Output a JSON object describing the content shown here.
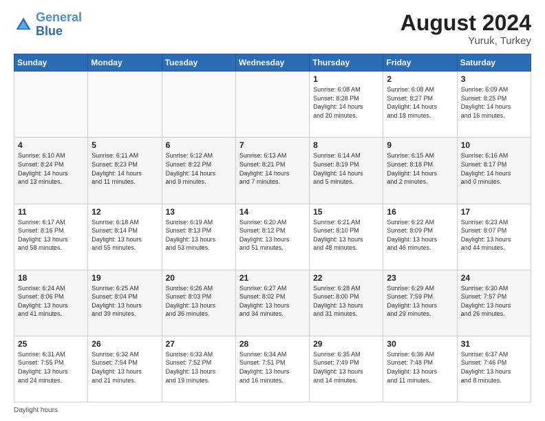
{
  "header": {
    "logo_text_general": "General",
    "logo_text_blue": "Blue",
    "month_year": "August 2024",
    "location": "Yuruk, Turkey"
  },
  "footer": {
    "daylight_label": "Daylight hours"
  },
  "days_of_week": [
    "Sunday",
    "Monday",
    "Tuesday",
    "Wednesday",
    "Thursday",
    "Friday",
    "Saturday"
  ],
  "weeks": [
    {
      "days": [
        {
          "number": "",
          "info": ""
        },
        {
          "number": "",
          "info": ""
        },
        {
          "number": "",
          "info": ""
        },
        {
          "number": "",
          "info": ""
        },
        {
          "number": "1",
          "info": "Sunrise: 6:08 AM\nSunset: 8:28 PM\nDaylight: 14 hours\nand 20 minutes."
        },
        {
          "number": "2",
          "info": "Sunrise: 6:08 AM\nSunset: 8:27 PM\nDaylight: 14 hours\nand 18 minutes."
        },
        {
          "number": "3",
          "info": "Sunrise: 6:09 AM\nSunset: 8:25 PM\nDaylight: 14 hours\nand 16 minutes."
        }
      ]
    },
    {
      "days": [
        {
          "number": "4",
          "info": "Sunrise: 6:10 AM\nSunset: 8:24 PM\nDaylight: 14 hours\nand 13 minutes."
        },
        {
          "number": "5",
          "info": "Sunrise: 6:11 AM\nSunset: 8:23 PM\nDaylight: 14 hours\nand 11 minutes."
        },
        {
          "number": "6",
          "info": "Sunrise: 6:12 AM\nSunset: 8:22 PM\nDaylight: 14 hours\nand 9 minutes."
        },
        {
          "number": "7",
          "info": "Sunrise: 6:13 AM\nSunset: 8:21 PM\nDaylight: 14 hours\nand 7 minutes."
        },
        {
          "number": "8",
          "info": "Sunrise: 6:14 AM\nSunset: 8:19 PM\nDaylight: 14 hours\nand 5 minutes."
        },
        {
          "number": "9",
          "info": "Sunrise: 6:15 AM\nSunset: 8:18 PM\nDaylight: 14 hours\nand 2 minutes."
        },
        {
          "number": "10",
          "info": "Sunrise: 6:16 AM\nSunset: 8:17 PM\nDaylight: 14 hours\nand 0 minutes."
        }
      ]
    },
    {
      "days": [
        {
          "number": "11",
          "info": "Sunrise: 6:17 AM\nSunset: 8:16 PM\nDaylight: 13 hours\nand 58 minutes."
        },
        {
          "number": "12",
          "info": "Sunrise: 6:18 AM\nSunset: 8:14 PM\nDaylight: 13 hours\nand 55 minutes."
        },
        {
          "number": "13",
          "info": "Sunrise: 6:19 AM\nSunset: 8:13 PM\nDaylight: 13 hours\nand 53 minutes."
        },
        {
          "number": "14",
          "info": "Sunrise: 6:20 AM\nSunset: 8:12 PM\nDaylight: 13 hours\nand 51 minutes."
        },
        {
          "number": "15",
          "info": "Sunrise: 6:21 AM\nSunset: 8:10 PM\nDaylight: 13 hours\nand 48 minutes."
        },
        {
          "number": "16",
          "info": "Sunrise: 6:22 AM\nSunset: 8:09 PM\nDaylight: 13 hours\nand 46 minutes."
        },
        {
          "number": "17",
          "info": "Sunrise: 6:23 AM\nSunset: 8:07 PM\nDaylight: 13 hours\nand 44 minutes."
        }
      ]
    },
    {
      "days": [
        {
          "number": "18",
          "info": "Sunrise: 6:24 AM\nSunset: 8:06 PM\nDaylight: 13 hours\nand 41 minutes."
        },
        {
          "number": "19",
          "info": "Sunrise: 6:25 AM\nSunset: 8:04 PM\nDaylight: 13 hours\nand 39 minutes."
        },
        {
          "number": "20",
          "info": "Sunrise: 6:26 AM\nSunset: 8:03 PM\nDaylight: 13 hours\nand 36 minutes."
        },
        {
          "number": "21",
          "info": "Sunrise: 6:27 AM\nSunset: 8:02 PM\nDaylight: 13 hours\nand 34 minutes."
        },
        {
          "number": "22",
          "info": "Sunrise: 6:28 AM\nSunset: 8:00 PM\nDaylight: 13 hours\nand 31 minutes."
        },
        {
          "number": "23",
          "info": "Sunrise: 6:29 AM\nSunset: 7:59 PM\nDaylight: 13 hours\nand 29 minutes."
        },
        {
          "number": "24",
          "info": "Sunrise: 6:30 AM\nSunset: 7:57 PM\nDaylight: 13 hours\nand 26 minutes."
        }
      ]
    },
    {
      "days": [
        {
          "number": "25",
          "info": "Sunrise: 6:31 AM\nSunset: 7:55 PM\nDaylight: 13 hours\nand 24 minutes."
        },
        {
          "number": "26",
          "info": "Sunrise: 6:32 AM\nSunset: 7:54 PM\nDaylight: 13 hours\nand 21 minutes."
        },
        {
          "number": "27",
          "info": "Sunrise: 6:33 AM\nSunset: 7:52 PM\nDaylight: 13 hours\nand 19 minutes."
        },
        {
          "number": "28",
          "info": "Sunrise: 6:34 AM\nSunset: 7:51 PM\nDaylight: 13 hours\nand 16 minutes."
        },
        {
          "number": "29",
          "info": "Sunrise: 6:35 AM\nSunset: 7:49 PM\nDaylight: 13 hours\nand 14 minutes."
        },
        {
          "number": "30",
          "info": "Sunrise: 6:36 AM\nSunset: 7:48 PM\nDaylight: 13 hours\nand 11 minutes."
        },
        {
          "number": "31",
          "info": "Sunrise: 6:37 AM\nSunset: 7:46 PM\nDaylight: 13 hours\nand 8 minutes."
        }
      ]
    }
  ]
}
